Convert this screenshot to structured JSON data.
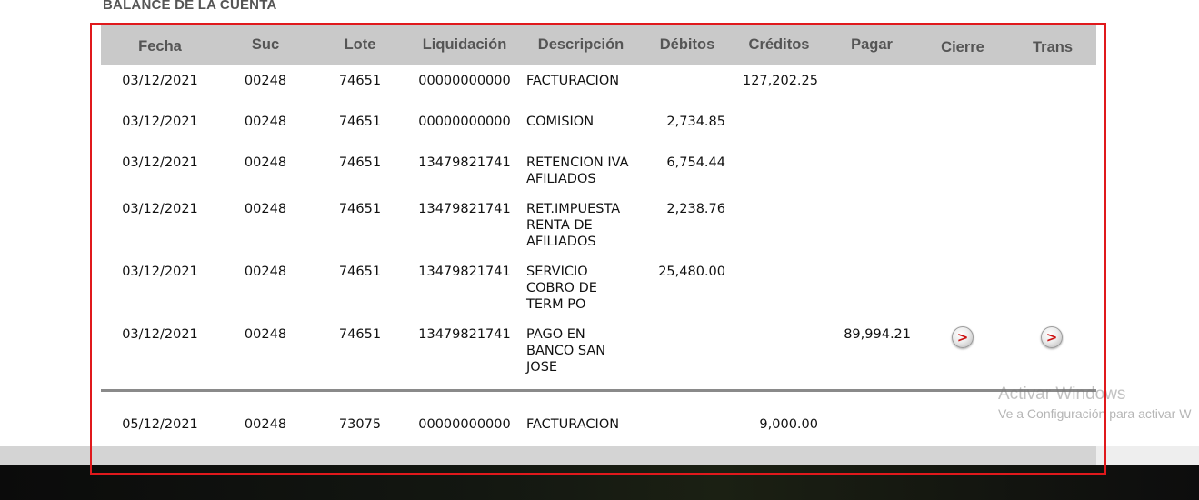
{
  "section": {
    "title": "BALANCE DE LA CUENTA"
  },
  "table": {
    "headers": {
      "fecha": "Fecha",
      "suc": "Suc",
      "lote": "Lote",
      "liquidacion": "Liquidación",
      "descripcion": "Descripción",
      "debitos": "Débitos",
      "creditos": "Créditos",
      "pagar": "Pagar",
      "cierre": "Cierre",
      "trans": "Trans"
    },
    "rows": [
      {
        "fecha": "03/12/2021",
        "suc": "00248",
        "lote": "74651",
        "liquidacion": "00000000000",
        "descripcion": "FACTURACION",
        "debitos": "",
        "creditos": "127,202.25",
        "pagar": ""
      },
      {
        "fecha": "03/12/2021",
        "suc": "00248",
        "lote": "74651",
        "liquidacion": "00000000000",
        "descripcion": "COMISION",
        "debitos": "2,734.85",
        "creditos": "",
        "pagar": ""
      },
      {
        "fecha": "03/12/2021",
        "suc": "00248",
        "lote": "74651",
        "liquidacion": "13479821741",
        "descripcion": "RETENCION IVA AFILIADOS",
        "debitos": "6,754.44",
        "creditos": "",
        "pagar": ""
      },
      {
        "fecha": "03/12/2021",
        "suc": "00248",
        "lote": "74651",
        "liquidacion": "13479821741",
        "descripcion": "RET.IMPUESTA RENTA DE AFILIADOS",
        "debitos": "2,238.76",
        "creditos": "",
        "pagar": ""
      },
      {
        "fecha": "03/12/2021",
        "suc": "00248",
        "lote": "74651",
        "liquidacion": "13479821741",
        "descripcion": "SERVICIO COBRO DE TERM PO",
        "debitos": "25,480.00",
        "creditos": "",
        "pagar": ""
      },
      {
        "fecha": "03/12/2021",
        "suc": "00248",
        "lote": "74651",
        "liquidacion": "13479821741",
        "descripcion": "PAGO EN BANCO SAN JOSE",
        "debitos": "",
        "creditos": "",
        "pagar": "89,994.21",
        "cierre_icon": "arrow-right-icon",
        "trans_icon": "arrow-right-icon"
      },
      {
        "fecha": "05/12/2021",
        "suc": "00248",
        "lote": "73075",
        "liquidacion": "00000000000",
        "descripcion": "FACTURACION",
        "debitos": "",
        "creditos": "9,000.00",
        "pagar": ""
      }
    ]
  },
  "arrow_glyph": ">",
  "watermark": {
    "title": "Activar Windows",
    "subtitle": "Ve a Configuración para activar W"
  },
  "colors": {
    "header_bg": "#c9c9c9",
    "header_text": "#555555",
    "frame_red": "#e0191c",
    "arrow_red": "#cc1111",
    "separator": "#8a8a8a"
  }
}
